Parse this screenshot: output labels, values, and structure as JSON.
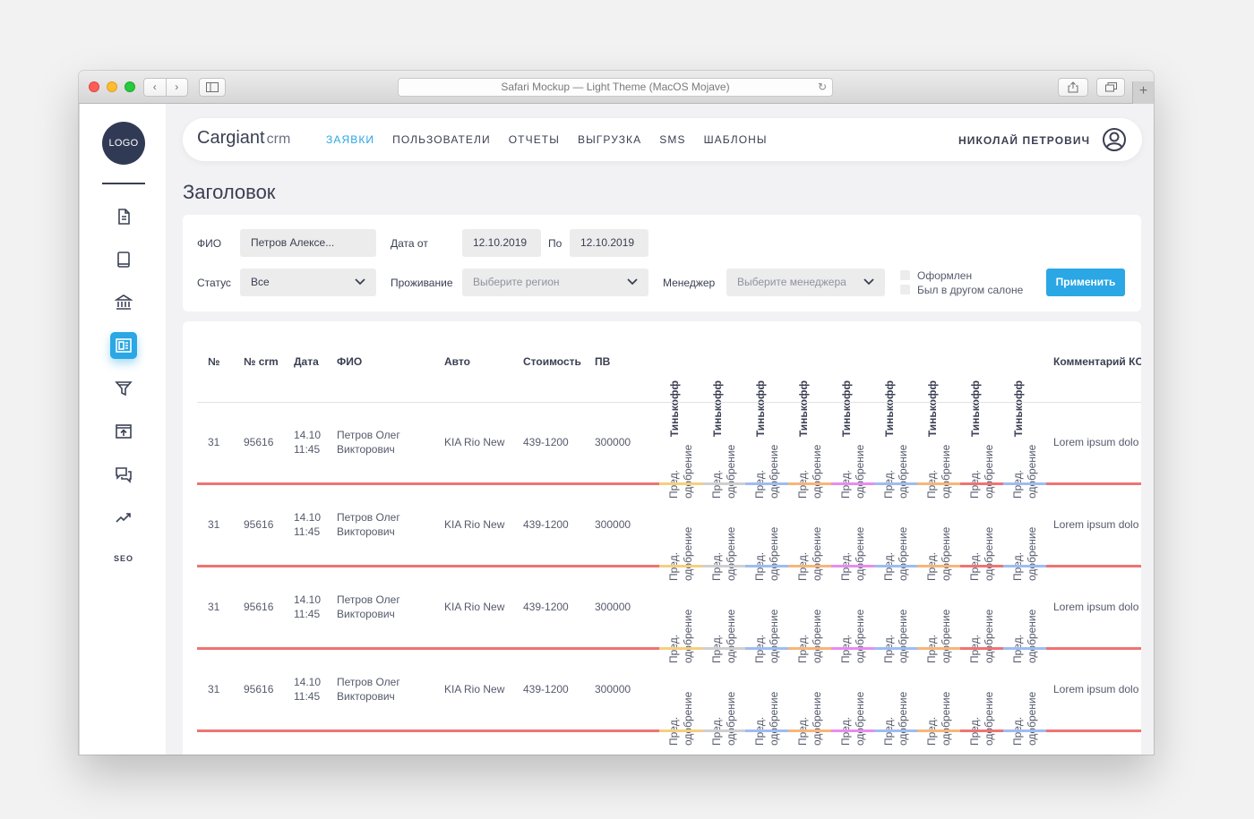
{
  "browser": {
    "url_title": "Safari Mockup — Light Theme (MacOS Mojave)",
    "nav_back": "‹",
    "nav_forward": "›",
    "new_tab": "+"
  },
  "sidebar": {
    "logo": "LOGO",
    "items": [
      {
        "name": "document-icon"
      },
      {
        "name": "tablet-icon"
      },
      {
        "name": "bank-icon"
      },
      {
        "name": "requests-icon",
        "active": true
      },
      {
        "name": "filter-icon"
      },
      {
        "name": "upload-icon"
      },
      {
        "name": "chat-icon"
      },
      {
        "name": "trend-icon"
      }
    ],
    "seo_label": "SEO"
  },
  "header": {
    "brand": "Cargiant",
    "brand_suffix": "crm",
    "nav": [
      "ЗАЯВКИ",
      "ПОЛЬЗОВАТЕЛИ",
      "ОТЧЕТЫ",
      "ВЫГРУЗКА",
      "SMS",
      "ШАБЛОНЫ"
    ],
    "active_nav": "ЗАЯВКИ",
    "user_name": "НИКОЛАЙ ПЕТРОВИЧ"
  },
  "page": {
    "title": "Заголовок"
  },
  "filters": {
    "fio_label": "ФИО",
    "fio_value": "Петров Алексе...",
    "date_from_label": "Дата от",
    "date_from_value": "12.10.2019",
    "date_to_label": "По",
    "date_to_value": "12.10.2019",
    "status_label": "Статус",
    "status_value": "Все",
    "residence_label": "Проживание",
    "residence_placeholder": "Выберите регион",
    "manager_label": "Менеджер",
    "manager_placeholder": "Выберите менеджера",
    "check_done": "Оформлен",
    "check_other_salon": "Был в другом салоне",
    "apply_label": "Применить"
  },
  "table": {
    "columns": {
      "num": "№",
      "crm": "№ crm",
      "date": "Дата",
      "fio": "ФИО",
      "auto": "Авто",
      "cost": "Стоимость",
      "pv": "ПВ",
      "bank": "Тинькофф",
      "comment": "Комментарий КО"
    },
    "bank_columns": 9,
    "status_text": [
      "Пред.",
      "одобрение"
    ],
    "status_colors": [
      "#f5cf7e",
      "#cfcfcf",
      "#9dbdf1",
      "#f7b57a",
      "#e88cf0",
      "#9dbdf1",
      "#f7b57a",
      "#ee7474",
      "#9dbdf1"
    ],
    "row_line_color": "#ee7474",
    "rows": [
      {
        "num": "31",
        "crm": "95616",
        "date": "14.10",
        "time": "11:45",
        "fio1": "Петров Олег",
        "fio2": "Викторович",
        "auto": "KIA Rio New",
        "cost": "439-1200",
        "pv": "300000",
        "comment": "Lorem ipsum dolo"
      },
      {
        "num": "31",
        "crm": "95616",
        "date": "14.10",
        "time": "11:45",
        "fio1": "Петров Олег",
        "fio2": "Викторович",
        "auto": "KIA Rio New",
        "cost": "439-1200",
        "pv": "300000",
        "comment": "Lorem ipsum dolo"
      },
      {
        "num": "31",
        "crm": "95616",
        "date": "14.10",
        "time": "11:45",
        "fio1": "Петров Олег",
        "fio2": "Викторович",
        "auto": "KIA Rio New",
        "cost": "439-1200",
        "pv": "300000",
        "comment": "Lorem ipsum dolo"
      },
      {
        "num": "31",
        "crm": "95616",
        "date": "14.10",
        "time": "11:45",
        "fio1": "Петров Олег",
        "fio2": "Викторович",
        "auto": "KIA Rio New",
        "cost": "439-1200",
        "pv": "300000",
        "comment": "Lorem ipsum dolo"
      }
    ]
  },
  "colors": {
    "accent": "#2aa7e4",
    "dark": "#313a55",
    "panel_bg": "#f2f2f4",
    "input_bg": "#ececec"
  }
}
